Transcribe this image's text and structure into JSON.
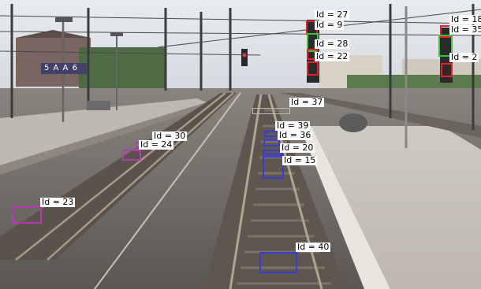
{
  "scene": {
    "sign_text": "5 A A 6",
    "colors": {
      "sky": "#dfe4ea",
      "ballast": "#6e6a66",
      "platform": "#c8c3bb",
      "rail": "#8c7f70",
      "signal": "#e8303a",
      "vegetation": "#5c7b4e"
    }
  },
  "detections": [
    {
      "label": "Id = 27",
      "class": "signal",
      "color": "#e5222c"
    },
    {
      "label": "Id = 9",
      "class": "signal",
      "color": "#e5222c"
    },
    {
      "label": "Id = 28",
      "class": "signal",
      "color": "#e5222c"
    },
    {
      "label": "Id = 22",
      "class": "signal",
      "color": "#e5222c"
    },
    {
      "label": "Id = 18",
      "class": "signal",
      "color": "#e5222c"
    },
    {
      "label": "Id = 35",
      "class": "signal",
      "color": "#3fc23f"
    },
    {
      "label": "Id = 2",
      "class": "signal",
      "color": "#e5222c"
    },
    {
      "label": "Id = 37",
      "class": "object",
      "color": "#9a9a9a"
    },
    {
      "label": "Id = 39",
      "class": "balise",
      "color": "#3a3ad4"
    },
    {
      "label": "Id = 36",
      "class": "balise",
      "color": "#3a3ad4"
    },
    {
      "label": "Id = 20",
      "class": "balise",
      "color": "#3a3ad4"
    },
    {
      "label": "Id = 15",
      "class": "balise",
      "color": "#3a3ad4"
    },
    {
      "label": "Id = 40",
      "class": "balise",
      "color": "#3a3ad4"
    },
    {
      "label": "Id = 30",
      "class": "balise",
      "color": "#b23bb2"
    },
    {
      "label": "Id = 24",
      "class": "balise",
      "color": "#b23bb2"
    },
    {
      "label": "Id = 23",
      "class": "balise",
      "color": "#b23bb2"
    }
  ]
}
